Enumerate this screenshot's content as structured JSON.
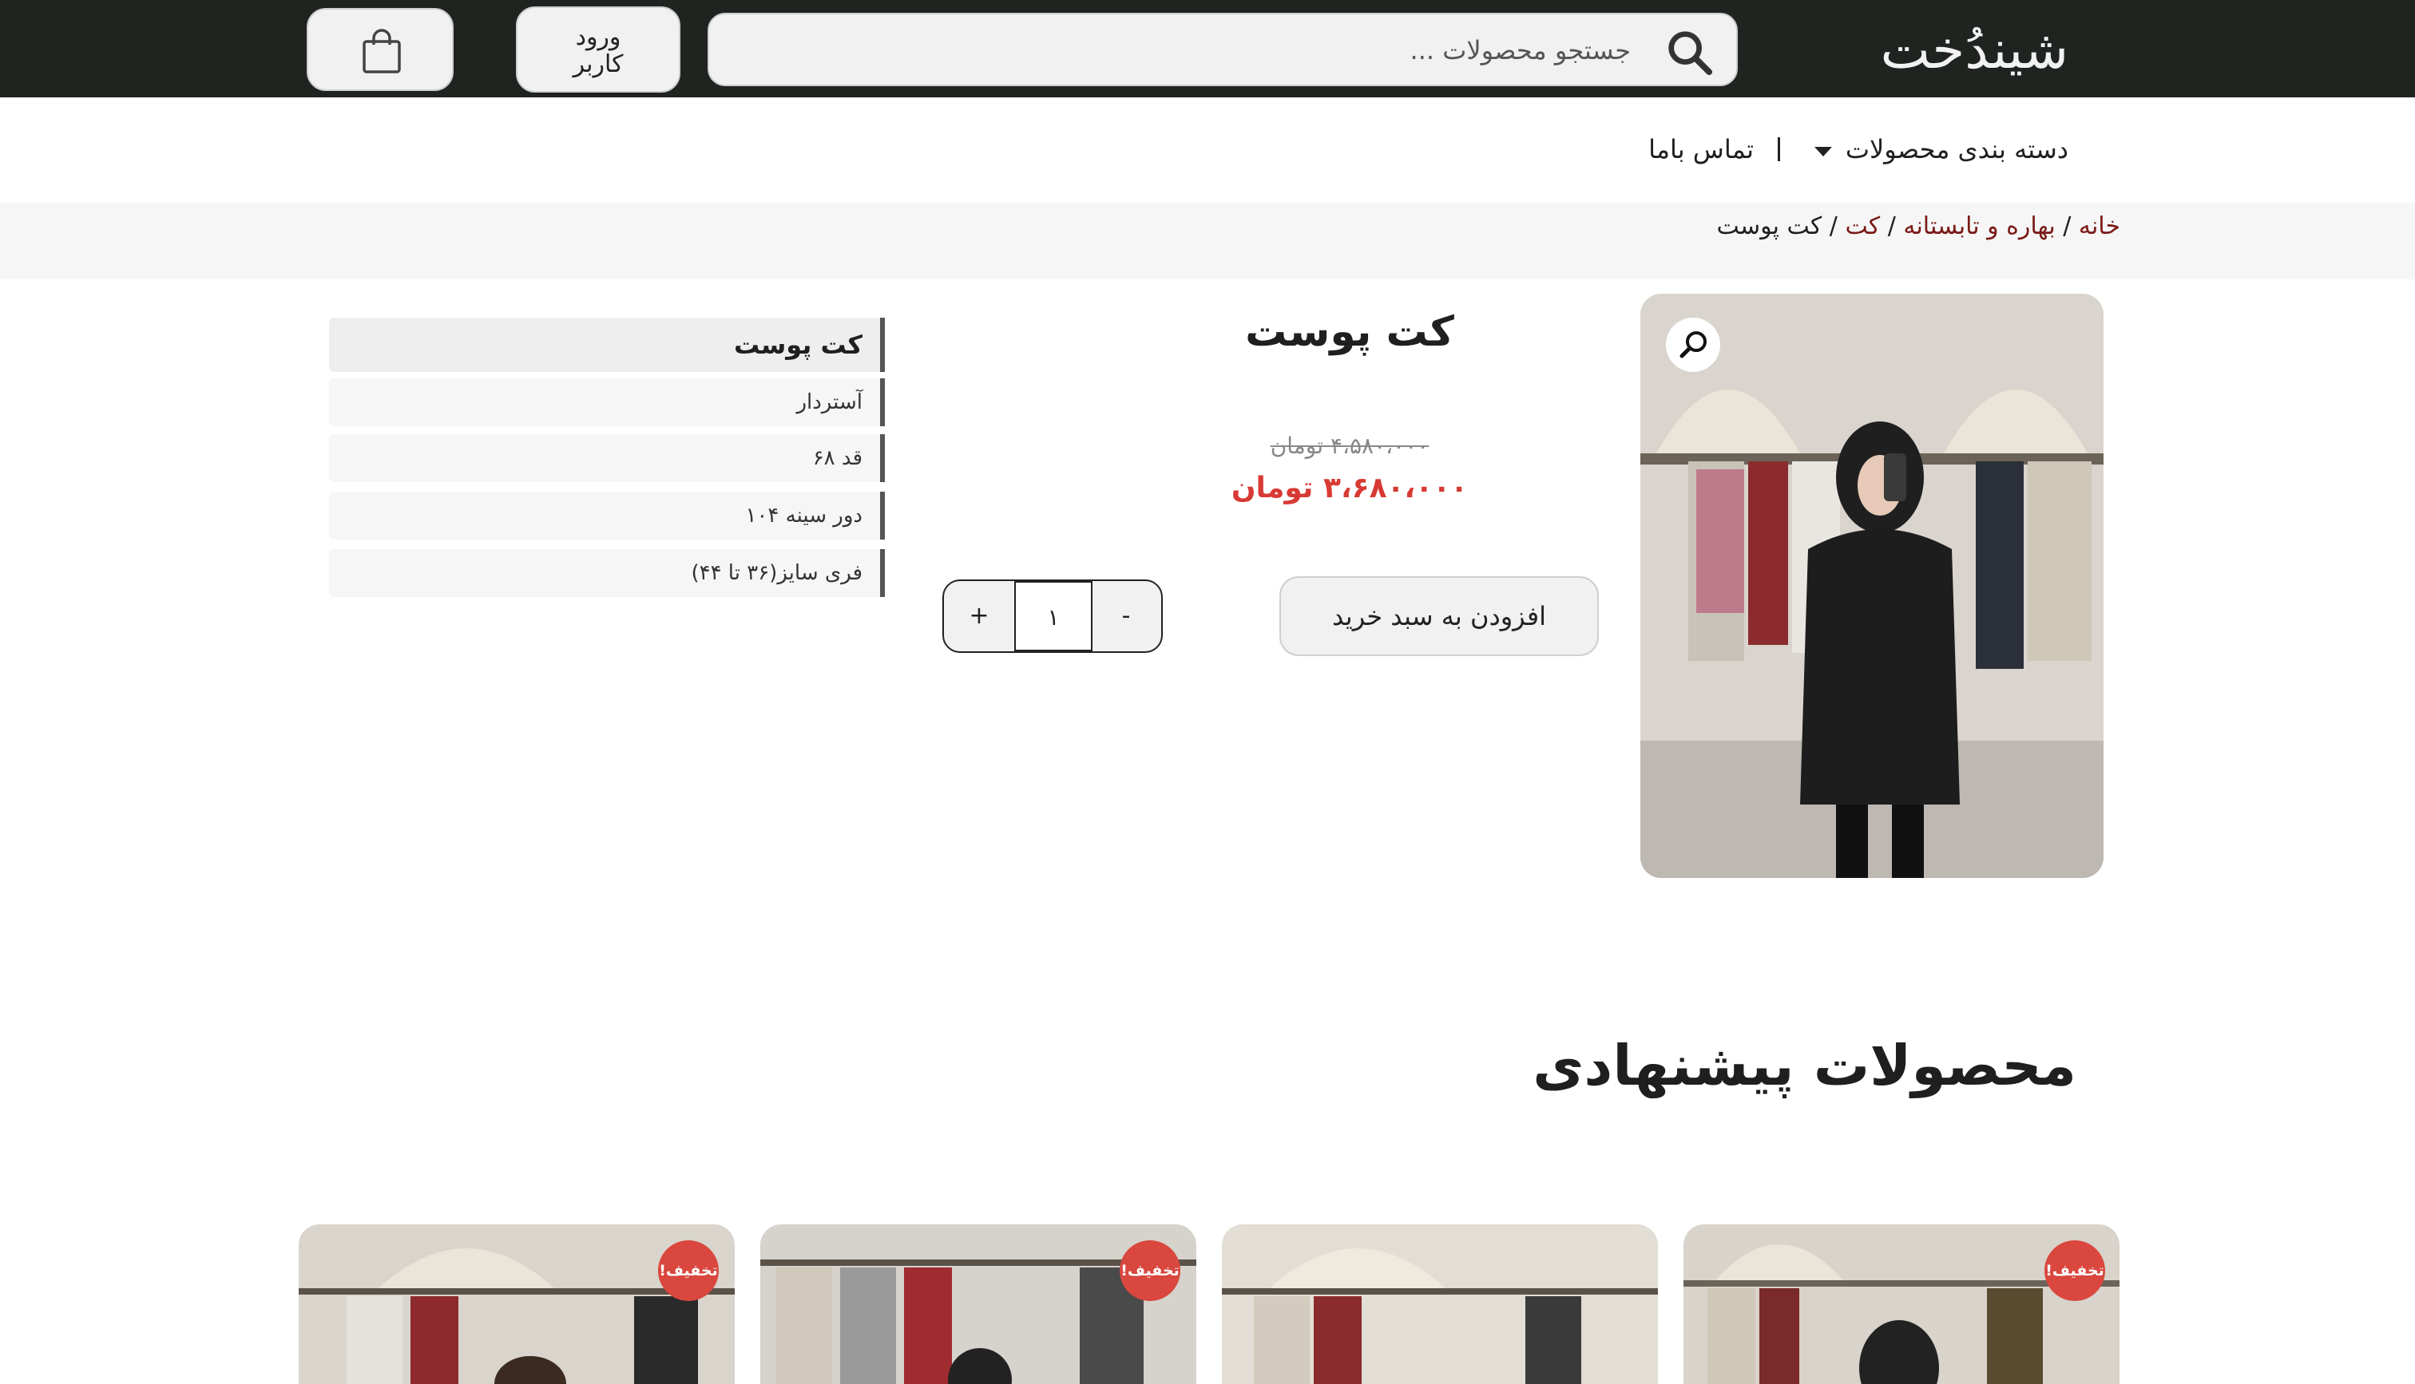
{
  "header": {
    "logo": "شیندُخت",
    "search_placeholder": "جستجو محصولات ...",
    "login_line1": "ورود",
    "login_line2": "کاربر"
  },
  "nav": {
    "categories": "دسته بندی محصولات",
    "contact": "تماس باما"
  },
  "breadcrumb": {
    "home": "خانه",
    "season": "بهاره و تابستانه",
    "category": "کت",
    "current": "کت پوست",
    "separator": " / "
  },
  "product": {
    "title": "کت پوست",
    "old_price": "۴،۵۸۰،۰۰۰ تومان",
    "new_price": "۳،۶۸۰،۰۰۰ تومان",
    "add_to_cart": "افزودن به سبد خرید",
    "quantity": "۱",
    "minus": "-",
    "plus": "+"
  },
  "attributes": {
    "heading": "کت پوست",
    "items": [
      "آستردار",
      "قد ۶۸",
      "دور سینه ۱۰۴",
      "فری سایز(۳۶ تا ۴۴)"
    ]
  },
  "suggested": {
    "title": "محصولات پیشنهادی",
    "badge": "تخفیف!"
  },
  "colors": {
    "topbar": "#1f2420",
    "accent_price": "#d83a34",
    "badge": "#d9473e",
    "breadcrumb_link": "#7a1a16"
  }
}
